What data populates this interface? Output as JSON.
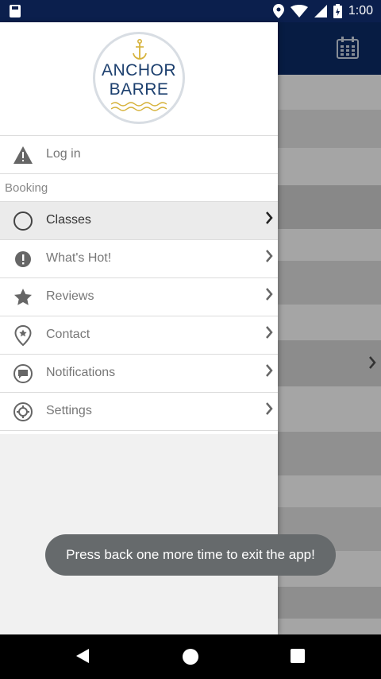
{
  "status_bar": {
    "time": "1:00"
  },
  "drawer": {
    "logo": {
      "line1": "ANCHOR",
      "line2": "BARRE"
    },
    "login_label": "Log in",
    "section_label": "Booking",
    "items": [
      {
        "label": "Classes",
        "icon": "circle-outline-icon",
        "active": true
      },
      {
        "label": "What's Hot!",
        "icon": "exclamation-circle-icon",
        "active": false
      },
      {
        "label": "Reviews",
        "icon": "star-icon",
        "active": false
      },
      {
        "label": "Contact",
        "icon": "location-pin-icon",
        "active": false
      },
      {
        "label": "Notifications",
        "icon": "chat-bubble-icon",
        "active": false
      },
      {
        "label": "Settings",
        "icon": "gear-icon",
        "active": false
      }
    ]
  },
  "toast": {
    "message": "Press back one more time to exit the app!"
  },
  "colors": {
    "header": "#0b2a63",
    "status_bar": "#0b1f4d",
    "logo_text": "#1c3f6e",
    "logo_accent": "#d6b23a"
  }
}
